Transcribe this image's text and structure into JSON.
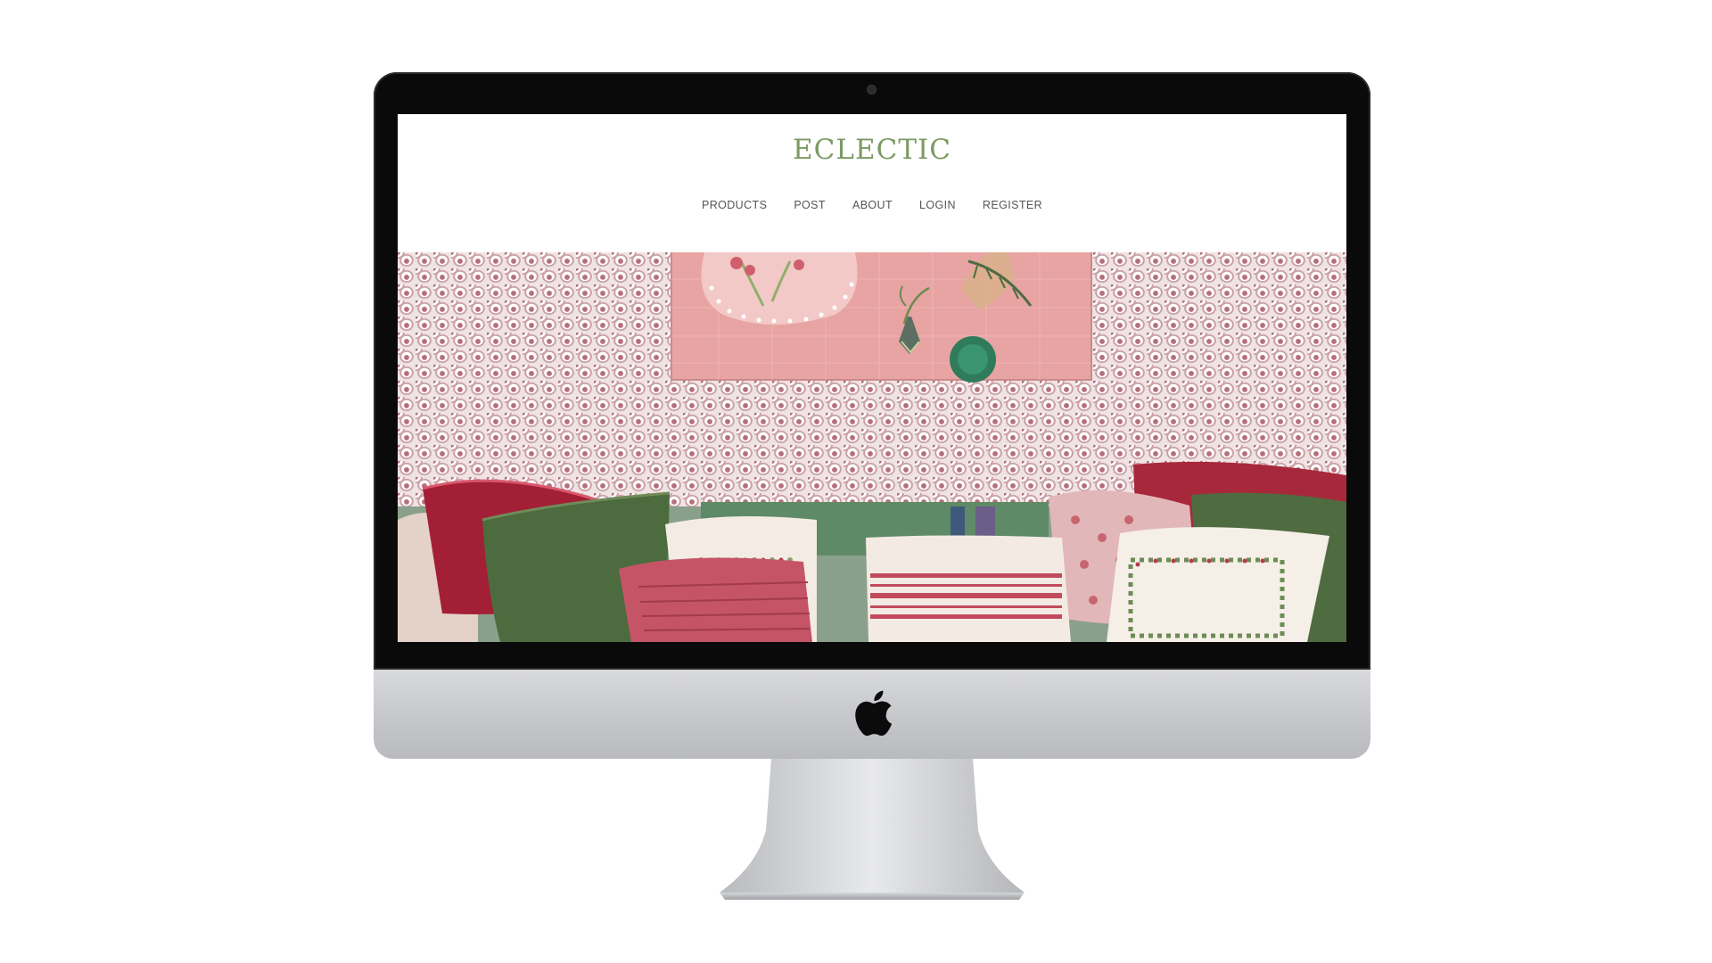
{
  "site": {
    "logo": "ECLECTIC",
    "nav": [
      {
        "label": "PRODUCTS"
      },
      {
        "label": "POST"
      },
      {
        "label": "ABOUT"
      },
      {
        "label": "LOGIN"
      },
      {
        "label": "REGISTER"
      }
    ]
  },
  "colors": {
    "logo": "#7c9a63",
    "nav_text": "#555555",
    "bezel": "#0a0a0a",
    "wallpaper": "#efe3e4"
  },
  "icons": {
    "device_logo": "apple-logo-icon"
  }
}
